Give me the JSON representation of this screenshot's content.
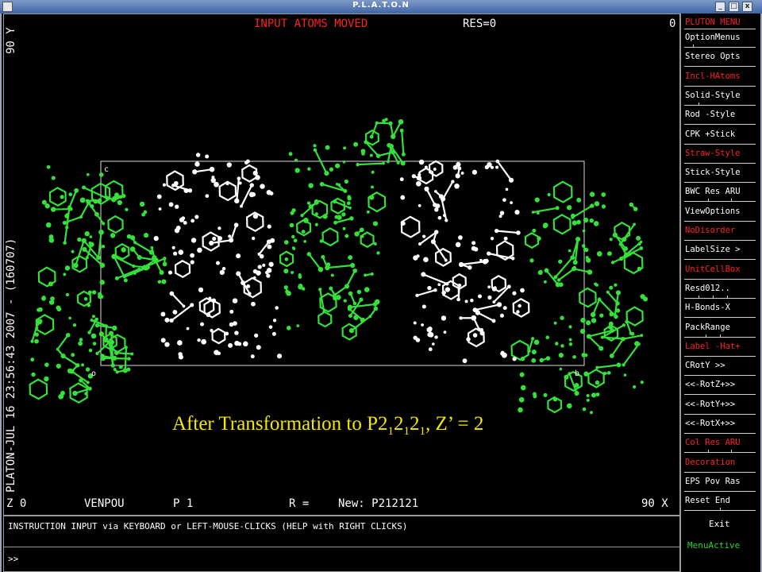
{
  "window": {
    "title": "P.L.A.T.O.N",
    "minimize": "_",
    "maximize": "□",
    "close": "x"
  },
  "status_top": {
    "message": "INPUT ATOMS MOVED",
    "res": "RES=0",
    "number": "0"
  },
  "left_vertical": {
    "y_label": "90 Y",
    "stamp": "PLATON-JUL 16 23:56:43 2007  -  (160707)"
  },
  "bottom_status": {
    "z": "Z  0",
    "name": "VENPOU",
    "space_group": "P 1",
    "r": "R =",
    "new": "New: P212121",
    "x_label": "90 X"
  },
  "unit_cell_labels": {
    "c": "c",
    "o": "o",
    "b": "b"
  },
  "caption": {
    "text1": "After Transformation  to P2",
    "s1": "1",
    "t2": "2",
    "s2": "1",
    "t3": "2",
    "s3": "1",
    "t4": ", Z’ = 2"
  },
  "menu": {
    "header": "PLUTON MENU",
    "items": [
      {
        "label": "OptionMenus",
        "red": false,
        "ticks": [
          0.12
        ]
      },
      {
        "label": "Stereo Opts",
        "red": false,
        "ticks": []
      },
      {
        "label": "Incl-HAtoms",
        "red": true,
        "ticks": []
      },
      {
        "label": "Solid-Style",
        "red": false,
        "ticks": [
          0.2
        ]
      },
      {
        "label": "Rod   -Style",
        "red": false,
        "ticks": []
      },
      {
        "label": "CPK  +Stick",
        "red": false,
        "ticks": []
      },
      {
        "label": "Straw-Style",
        "red": true,
        "ticks": []
      },
      {
        "label": "Stick-Style",
        "red": false,
        "ticks": []
      },
      {
        "label": "BWC Res ARU",
        "red": false,
        "ticks": [
          0.33,
          0.66
        ]
      },
      {
        "label": "ViewOptions",
        "red": false,
        "ticks": []
      },
      {
        "label": "NoDisorder",
        "red": true,
        "ticks": []
      },
      {
        "label": "LabelSize >",
        "red": false,
        "ticks": []
      },
      {
        "label": "UnitCellBox",
        "red": true,
        "ticks": []
      },
      {
        "label": "Resd012..",
        "red": false,
        "ticks": [
          0.2,
          0.4,
          0.6
        ]
      },
      {
        "label": "H-Bonds-X",
        "red": false,
        "ticks": []
      },
      {
        "label": "PackRange",
        "red": false,
        "ticks": [
          0.3,
          0.5
        ]
      },
      {
        "label": "Label -Hat+",
        "red": true,
        "ticks": []
      },
      {
        "label": "CRotY >>",
        "red": false,
        "ticks": []
      },
      {
        "label": "<<-RotZ+>>",
        "red": false,
        "ticks": []
      },
      {
        "label": "<<-RotY+>>",
        "red": false,
        "ticks": []
      },
      {
        "label": "<<-RotX+>>",
        "red": false,
        "ticks": []
      },
      {
        "label": "Col Res ARU",
        "red": true,
        "ticks": [
          0.33,
          0.66
        ]
      },
      {
        "label": "Decoration",
        "red": true,
        "ticks": []
      },
      {
        "label": "EPS Pov Ras",
        "red": false,
        "ticks": []
      },
      {
        "label": "Reset    End",
        "red": false,
        "ticks": [
          0.5
        ]
      }
    ]
  },
  "instruction": {
    "text": "INSTRUCTION INPUT via KEYBOARD or LEFT-MOUSE-CLICKS (HELP with RIGHT CLICKS)",
    "prompt": ">>"
  },
  "exit": {
    "label": "Exit"
  },
  "menu_active": "MenuActive",
  "colors": {
    "green": "#35e03a",
    "white": "#ffffff",
    "red": "#ff2020",
    "yellow": "#f5e800",
    "menu_active": "#2dd22d"
  }
}
